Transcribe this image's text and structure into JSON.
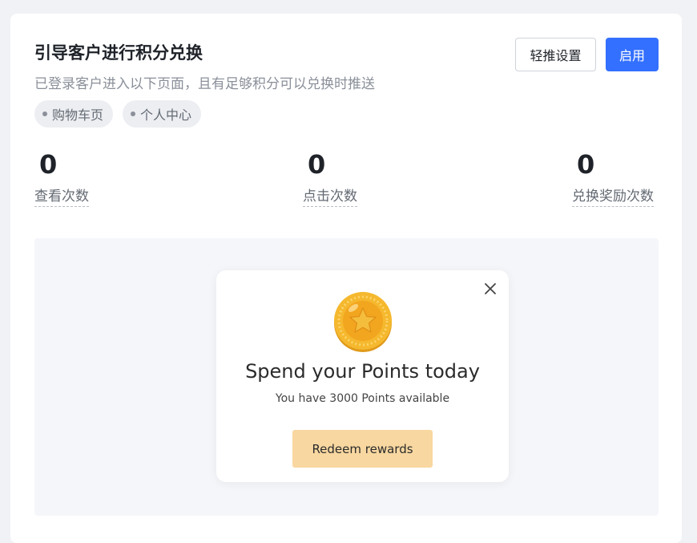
{
  "header": {
    "title": "引导客户进行积分兑换",
    "subtitle": "已登录客户进入以下页面，且有足够积分可以兑换时推送",
    "config_label": "轻推设置",
    "enable_label": "启用"
  },
  "pages": [
    {
      "label": "购物车页"
    },
    {
      "label": "个人中心"
    }
  ],
  "stats": [
    {
      "value": "0",
      "label": "查看次数"
    },
    {
      "value": "0",
      "label": "点击次数"
    },
    {
      "value": "0",
      "label": "兑换奖励次数"
    }
  ],
  "popup": {
    "icon": "star-coin-icon",
    "title": "Spend your Points today",
    "subtitle": "You have 3000 Points available",
    "button_label": "Redeem rewards"
  },
  "colors": {
    "primary": "#3370ff",
    "coin": "#f5b82e",
    "redeem_button": "#f8d7a0"
  }
}
